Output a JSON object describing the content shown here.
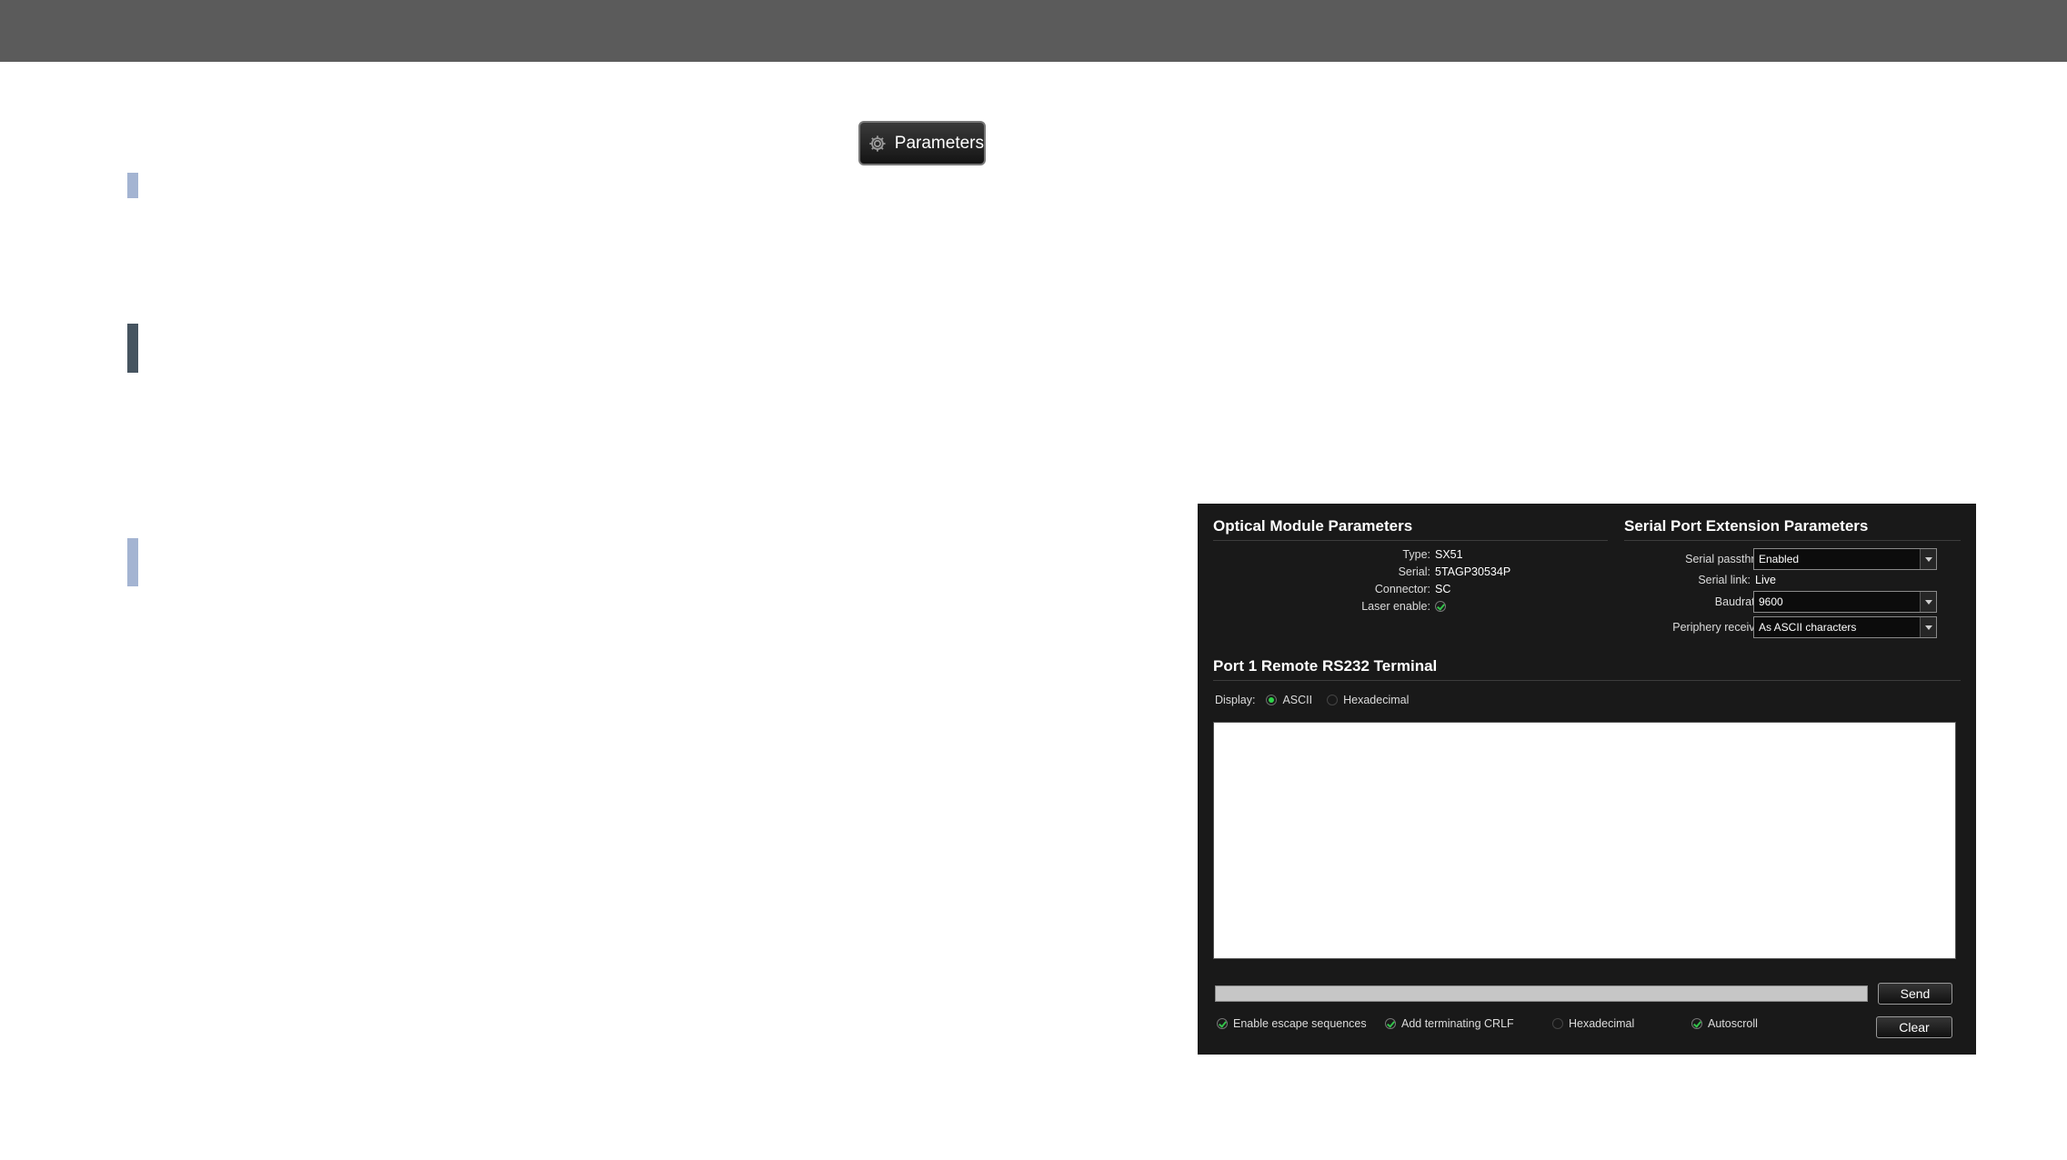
{
  "parameters_button": {
    "label": "Parameters",
    "icon": "gear-icon"
  },
  "optical": {
    "title": "Optical Module Parameters",
    "fields": [
      {
        "label": "Type:",
        "value": "SX51"
      },
      {
        "label": "Serial:",
        "value": "5TAGP30534P"
      },
      {
        "label": "Connector:",
        "value": "SC"
      },
      {
        "label": "Laser enable:",
        "value": ""
      }
    ]
  },
  "serial": {
    "title": "Serial Port Extension Parameters",
    "passthru_label": "Serial passthru:",
    "passthru_value": "Enabled",
    "link_label": "Serial link:",
    "link_value": "Live",
    "baud_label": "Baudrate:",
    "baud_value": "9600",
    "periphery_label": "Periphery receive:",
    "periphery_value": "As ASCII characters"
  },
  "terminal": {
    "title": "Port 1 Remote RS232 Terminal",
    "display_label": "Display:",
    "display_options": [
      "ASCII",
      "Hexadecimal"
    ],
    "display_selected": "ASCII",
    "send_label": "Send",
    "clear_label": "Clear",
    "options": [
      {
        "label": "Enable escape sequences",
        "checked": true
      },
      {
        "label": "Add terminating CRLF",
        "checked": true
      },
      {
        "label": "Hexadecimal",
        "checked": false
      },
      {
        "label": "Autoscroll",
        "checked": true
      }
    ]
  },
  "colors": {
    "topbar": "#5b5b5b",
    "panel_bg": "#191919",
    "check_green": "#33c24a",
    "marker_light": "#a4b4d2",
    "marker_dark": "#465460"
  }
}
